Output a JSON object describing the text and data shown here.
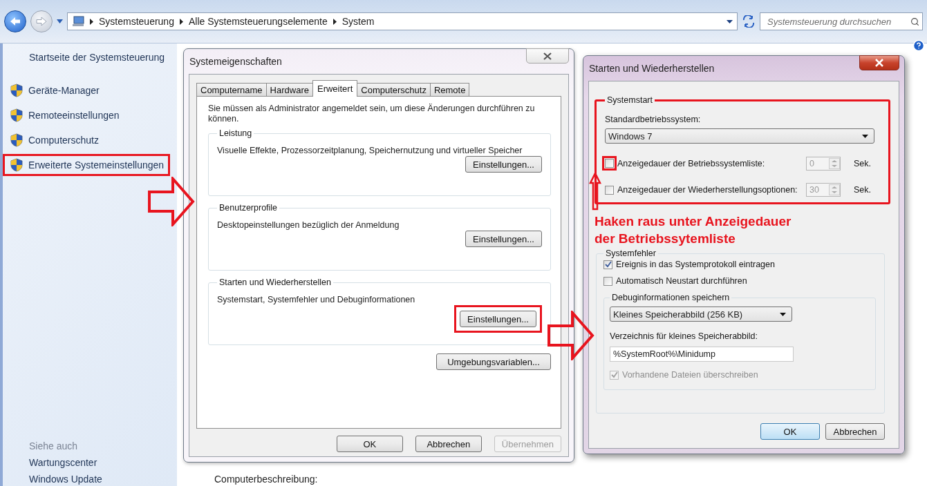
{
  "nav": {
    "breadcrumb": [
      "Systemsteuerung",
      "Alle Systemsteuerungselemente",
      "System"
    ],
    "search": {
      "placeholder": "Systemsteuerung durchsuchen"
    }
  },
  "sidebar": {
    "home": "Startseite der Systemsteuerung",
    "links": [
      {
        "label": "Geräte-Manager",
        "highlighted": false
      },
      {
        "label": "Remoteeinstellungen",
        "highlighted": false
      },
      {
        "label": "Computerschutz",
        "highlighted": false
      },
      {
        "label": "Erweiterte Systemeinstellungen",
        "highlighted": true
      }
    ],
    "see_also": {
      "title": "Siehe auch",
      "links": [
        "Wartungscenter",
        "Windows Update"
      ]
    }
  },
  "main": {
    "field_label": "Computerbeschreibung:"
  },
  "system_properties": {
    "title": "Systemeigenschaften",
    "tabs": [
      {
        "label": "Computername",
        "selected": false
      },
      {
        "label": "Hardware",
        "selected": false
      },
      {
        "label": "Erweitert",
        "selected": true
      },
      {
        "label": "Computerschutz",
        "selected": false
      },
      {
        "label": "Remote",
        "selected": false
      }
    ],
    "notice": "Sie müssen als Administrator angemeldet sein, um diese Änderungen durchführen zu können.",
    "groups": [
      {
        "title": "Leistung",
        "description": "Visuelle Effekte, Prozessorzeitplanung, Speichernutzung und virtueller Speicher",
        "button": {
          "label": "Einstellungen...",
          "highlighted": false
        }
      },
      {
        "title": "Benutzerprofile",
        "description": "Desktopeinstellungen bezüglich der Anmeldung",
        "button": {
          "label": "Einstellungen...",
          "highlighted": false
        }
      },
      {
        "title": "Starten und Wiederherstellen",
        "description": "Systemstart, Systemfehler und Debuginformationen",
        "button": {
          "label": "Einstellungen...",
          "highlighted": true
        }
      }
    ],
    "env_button": "Umgebungsvariablen...",
    "buttons": [
      {
        "label": "OK",
        "disabled": false
      },
      {
        "label": "Abbrechen",
        "disabled": false
      },
      {
        "label": "Übernehmen",
        "disabled": true
      }
    ]
  },
  "startup_dialog": {
    "title": "Starten und Wiederherstellen",
    "systemstart": {
      "title": "Systemstart",
      "highlighted": true,
      "os_label": "Standardbetriebssystem:",
      "os_value": "Windows 7",
      "timeouts": [
        {
          "label": "Anzeigedauer der Betriebssystemliste:",
          "checked": false,
          "highlighted": true,
          "value": "0",
          "unit": "Sek."
        },
        {
          "label": "Anzeigedauer der Wiederherstellungsoptionen:",
          "checked": false,
          "highlighted": false,
          "value": "30",
          "unit": "Sek."
        }
      ]
    },
    "annotation": "Haken raus unter Anzeigedauer der Betriebssytemliste",
    "systemfehler": {
      "title": "Systemfehler",
      "options": [
        {
          "label": "Ereignis in das Systemprotokoll eintragen",
          "checked": true,
          "disabled": false
        },
        {
          "label": "Automatisch Neustart durchführen",
          "checked": false,
          "disabled": false
        }
      ],
      "debug": {
        "title": "Debuginformationen speichern",
        "dump_type": "Kleines Speicherabbild (256 KB)",
        "dir_label": "Verzeichnis für kleines Speicherabbild:",
        "dir_value": "%SystemRoot%\\Minidump",
        "overwrite": {
          "label": "Vorhandene Dateien überschreiben",
          "checked": true,
          "disabled": true
        }
      }
    },
    "buttons": [
      {
        "label": "OK",
        "default": true
      },
      {
        "label": "Abbrechen",
        "default": false
      }
    ]
  }
}
